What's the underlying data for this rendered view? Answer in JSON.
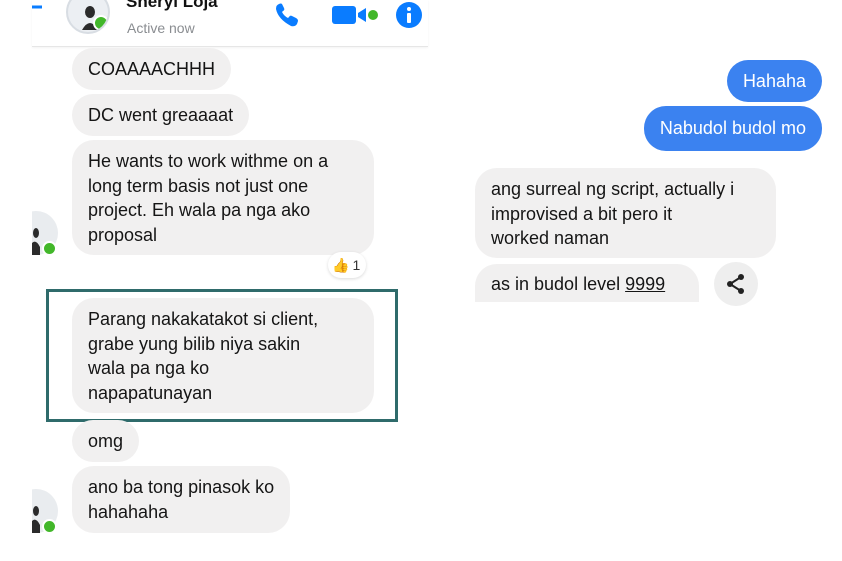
{
  "header": {
    "contact_name": "Sheryl Loja",
    "status": "Active now",
    "icons": [
      "back-arrow-icon",
      "phone-icon",
      "video-icon",
      "info-icon"
    ]
  },
  "left_thread": {
    "messages": [
      {
        "text": "COAAAACHHH"
      },
      {
        "text": "DC went greaaaat"
      },
      {
        "lines": [
          "He wants to work withme on a",
          "long term basis not just one",
          "project. Eh wala pa nga ako",
          "proposal"
        ]
      },
      {
        "lines": [
          "Parang nakakatakot si client,",
          "grabe yung bilib niya sakin",
          "wala pa nga ko",
          "napapatunayan"
        ]
      },
      {
        "text": "omg"
      },
      {
        "lines": [
          "ano ba tong pinasok ko",
          "hahahaha"
        ]
      }
    ],
    "reaction": {
      "emoji": "👍",
      "count": "1"
    }
  },
  "right_thread": {
    "sent": [
      "Hahaha",
      "Nabudol budol mo"
    ],
    "received": [
      {
        "lines": [
          "ang surreal ng script, actually i",
          "improvised a bit pero it",
          "worked naman"
        ]
      },
      {
        "prefix": "as in budol level ",
        "underlined": "9999"
      }
    ]
  },
  "colors": {
    "sent_bubble": "#3b82f0",
    "received_bubble": "#f1f0f0",
    "accent": "#0a7cff",
    "online": "#42b72a",
    "highlight_frame": "#2f6b6b"
  }
}
